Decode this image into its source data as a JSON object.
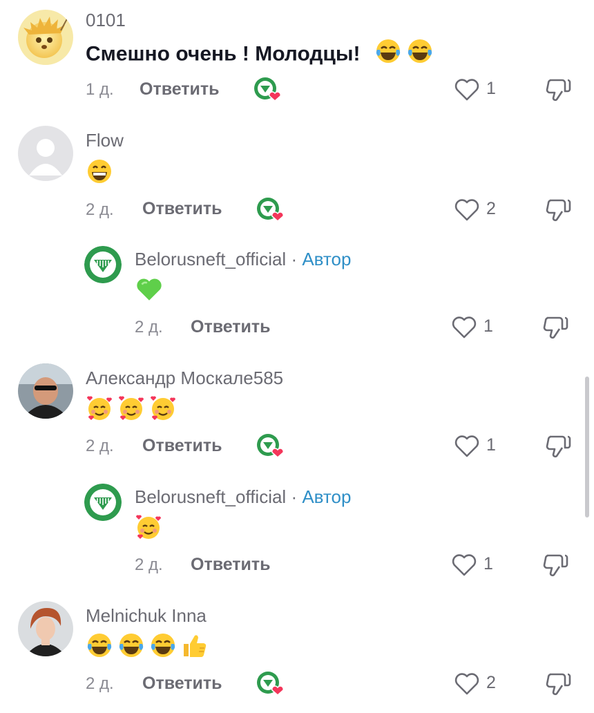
{
  "comments": [
    {
      "username": "0101",
      "text": "Смешно очень ! Молодцы!",
      "emojis": [
        "laugh-cry",
        "laugh-cry"
      ],
      "time": "1 д.",
      "reply_label": "Ответить",
      "likes": "1",
      "avatar": "yellow-hedgehog-avatar",
      "author_liked": true
    },
    {
      "username": "Flow",
      "text": "",
      "emojis": [
        "grin"
      ],
      "time": "2 д.",
      "reply_label": "Ответить",
      "likes": "2",
      "avatar": "default-avatar",
      "author_liked": true
    },
    {
      "username": "Belorusneft_official",
      "separator": " · ",
      "author_tag": "Автор",
      "text": "",
      "emojis": [
        "green-heart"
      ],
      "time": "2 д.",
      "reply_label": "Ответить",
      "likes": "1",
      "avatar": "belorusneft-logo"
    },
    {
      "username": "Александр Москале585",
      "text": "",
      "emojis": [
        "smiling-hearts",
        "smiling-hearts",
        "smiling-hearts"
      ],
      "time": "2 д.",
      "reply_label": "Ответить",
      "likes": "1",
      "avatar": "man-sunglasses-avatar",
      "author_liked": true
    },
    {
      "username": "Belorusneft_official",
      "separator": " · ",
      "author_tag": "Автор",
      "text": "",
      "emojis": [
        "smiling-hearts"
      ],
      "time": "2 д.",
      "reply_label": "Ответить",
      "likes": "1",
      "avatar": "belorusneft-logo"
    },
    {
      "username": "Melnichuk Inna",
      "text": "",
      "emojis": [
        "laugh-cry",
        "laugh-cry",
        "laugh-cry",
        "thumbs-up"
      ],
      "time": "2 д.",
      "reply_label": "Ответить",
      "likes": "2",
      "avatar": "woman-avatar",
      "author_liked": true
    }
  ],
  "colors": {
    "author_tag": "#2f8fc7",
    "logo_green": "#2e9b4e",
    "heart_red": "#f4365a"
  }
}
